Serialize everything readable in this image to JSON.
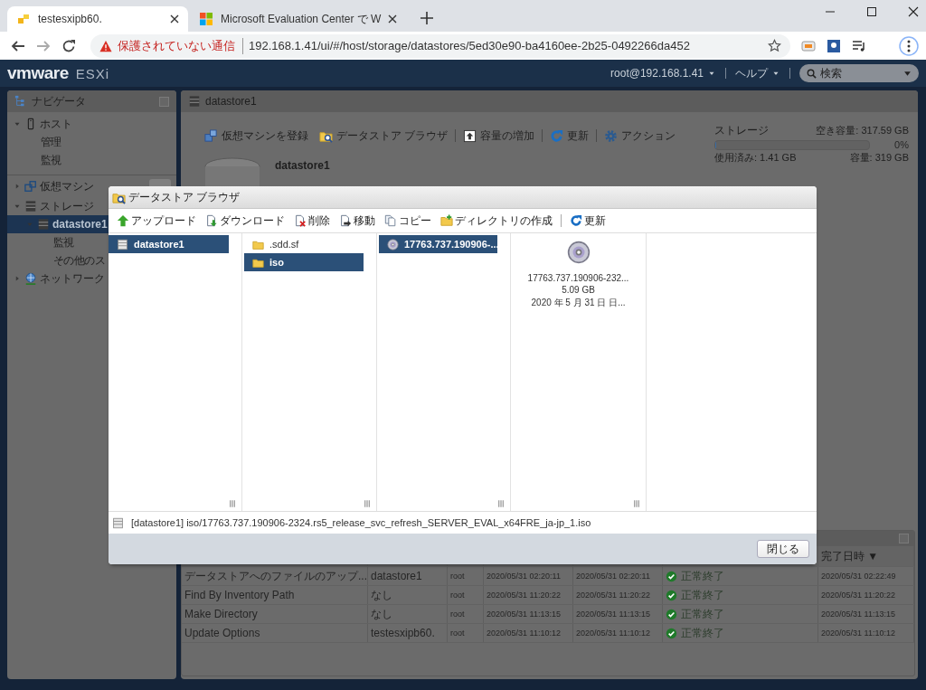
{
  "browser": {
    "tabs": [
      {
        "title": "testesxipb60.",
        "selected": true
      },
      {
        "title": "Microsoft Evaluation Center で W",
        "selected": false
      }
    ],
    "address": {
      "security": "保護されていない通信",
      "url": "192.168.1.41/ui/#/host/storage/datastores/5ed30e90-ba4160ee-2b25-0492266da452"
    }
  },
  "header": {
    "logo": "vmware",
    "product": "ESXi",
    "user": "root@192.168.1.41",
    "help": "ヘルプ",
    "search": {
      "placeholder": "検索"
    }
  },
  "navigator": {
    "title": "ナビゲータ",
    "items": [
      {
        "label": "ホスト",
        "expanded": true,
        "selected": false,
        "children": [
          {
            "label": "管理",
            "selected": false
          },
          {
            "label": "監視",
            "selected": false
          }
        ]
      },
      {
        "label": "仮想マシン",
        "expanded": false,
        "selected": false
      },
      {
        "label": "ストレージ",
        "expanded": true,
        "selected": false,
        "children": [
          {
            "label": "datastore1",
            "expanded": true,
            "selected": true,
            "children": [
              {
                "label": "監視",
                "selected": false
              },
              {
                "label": "その他のス",
                "selected": false
              }
            ]
          }
        ]
      },
      {
        "label": "ネットワーク",
        "expanded": false,
        "selected": false
      }
    ]
  },
  "main": {
    "title": "datastore1",
    "toolbar": [
      {
        "label": "仮想マシンを登録",
        "divider_after": false
      },
      {
        "label": "データストア ブラウザ",
        "divider_after": true
      },
      {
        "label": "容量の増加",
        "divider_after": true
      },
      {
        "label": "更新",
        "divider_after": true
      },
      {
        "label": "アクション",
        "divider_after": false
      }
    ],
    "storage": {
      "label": "ストレージ",
      "free": "空き容量: 317.59 GB",
      "percent": "0%",
      "level": 0.004,
      "used": "使用済み: 1.41 GB",
      "capacity": "容量: 319 GB"
    },
    "datastore": {
      "name": "datastore1"
    },
    "tasks": {
      "sorted_column": "完了日時 ▼",
      "rows": [
        {
          "cells": [
            "データストアへのファイルのアップ...",
            "datastore1",
            "root",
            "2020/05/31 02:20:11",
            "2020/05/31 02:20:11",
            "正常終了",
            "2020/05/31 02:22:49"
          ]
        },
        {
          "cells": [
            "Find By Inventory Path",
            "なし",
            "root",
            "2020/05/31 11:20:22",
            "2020/05/31 11:20:22",
            "正常終了",
            "2020/05/31 11:20:22"
          ]
        },
        {
          "cells": [
            "Make Directory",
            "なし",
            "root",
            "2020/05/31 11:13:15",
            "2020/05/31 11:13:15",
            "正常終了",
            "2020/05/31 11:13:15"
          ]
        },
        {
          "cells": [
            "Update Options",
            "testesxipb60.",
            "root",
            "2020/05/31 11:10:12",
            "2020/05/31 11:10:12",
            "正常終了",
            "2020/05/31 11:10:12"
          ]
        }
      ]
    }
  },
  "dialog": {
    "title": "データストア ブラウザ",
    "toolbar": [
      {
        "label": "アップロード",
        "divider_after": false
      },
      {
        "label": "ダウンロード",
        "divider_after": false
      },
      {
        "label": "削除",
        "divider_after": false
      },
      {
        "label": "移動",
        "divider_after": false
      },
      {
        "label": "コピー",
        "divider_after": false
      },
      {
        "label": "ディレクトリの作成",
        "divider_after": true
      },
      {
        "label": "更新",
        "divider_after": false
      }
    ],
    "columns": [
      {
        "items": [
          {
            "label": "datastore1",
            "selected": true
          }
        ]
      },
      {
        "items": [
          {
            "label": ".sdd.sf",
            "selected": false
          },
          {
            "label": "iso",
            "selected": true
          }
        ]
      },
      {
        "items": [
          {
            "label": "17763.737.190906-...",
            "selected": true
          }
        ]
      }
    ],
    "preview": {
      "name": "17763.737.190906-232...",
      "size": "5.09 GB",
      "date": "2020 年 5 月 31 日 日..."
    },
    "path": "[datastore1] iso/17763.737.190906-2324.rs5_release_svc_refresh_SERVER_EVAL_x64FRE_ja-jp_1.iso",
    "close_button": "閉じる"
  }
}
